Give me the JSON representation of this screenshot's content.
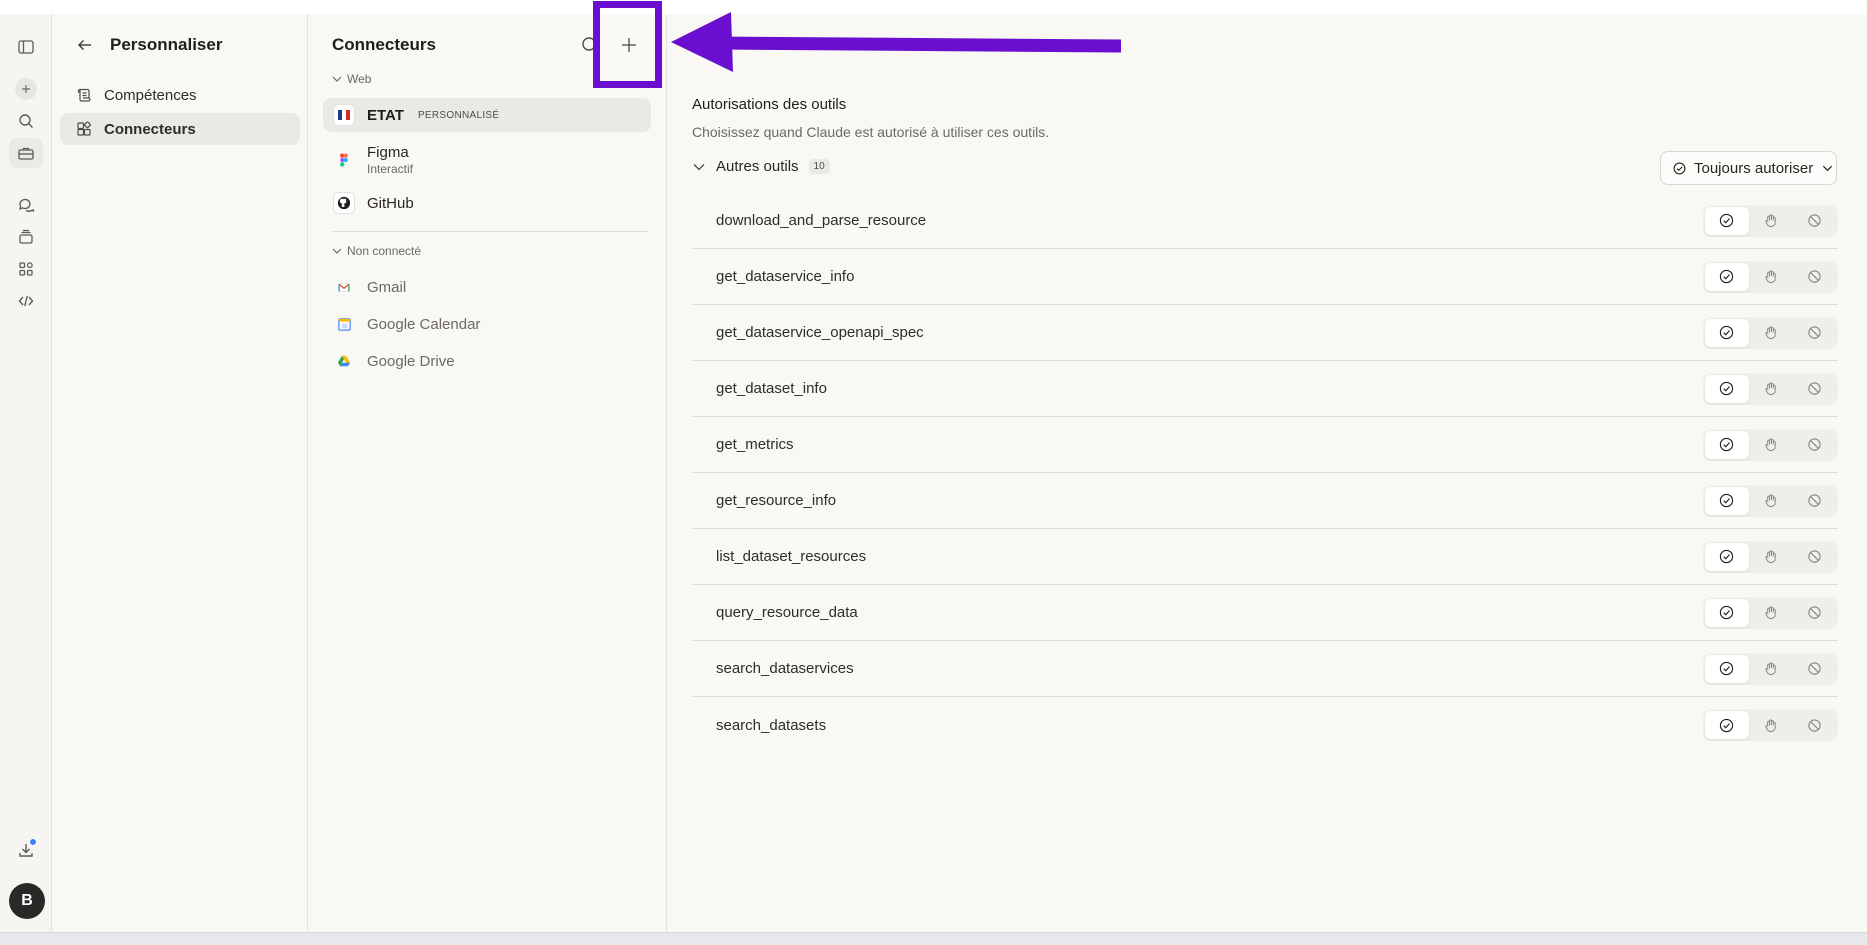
{
  "settings": {
    "back_label": "Personnaliser",
    "nav": [
      {
        "label": "Compétences",
        "active": false
      },
      {
        "label": "Connecteurs",
        "active": true
      }
    ]
  },
  "connectors": {
    "title": "Connecteurs",
    "sections": {
      "web": "Web",
      "not_connected": "Non connecté"
    },
    "connected": [
      {
        "name": "ETAT",
        "tag": "PERSONNALISÉ",
        "sub": ""
      },
      {
        "name": "Figma",
        "tag": "",
        "sub": "Interactif"
      },
      {
        "name": "GitHub",
        "tag": "",
        "sub": ""
      }
    ],
    "available": [
      {
        "name": "Gmail"
      },
      {
        "name": "Google Calendar"
      },
      {
        "name": "Google Drive"
      }
    ]
  },
  "permissions": {
    "title": "Autorisations des outils",
    "subtitle": "Choisissez quand Claude est autorisé à utiliser ces outils.",
    "group_label": "Autres outils",
    "group_count": "10",
    "bulk_label": "Toujours autoriser",
    "tools": [
      "download_and_parse_resource",
      "get_dataservice_info",
      "get_dataservice_openapi_spec",
      "get_dataset_info",
      "get_metrics",
      "get_resource_info",
      "list_dataset_resources",
      "query_resource_data",
      "search_dataservices",
      "search_datasets"
    ]
  },
  "user": {
    "initial": "B"
  },
  "colors": {
    "highlight": "#6a0fd0",
    "notification": "#3b82f6"
  },
  "icons": [
    "sidebar-toggle-icon",
    "plus-icon",
    "search-icon",
    "toolbox-icon",
    "chats-icon",
    "projects-icon",
    "artifacts-icon",
    "code-icon",
    "download-icon",
    "back-arrow-icon",
    "check-circle-icon",
    "hand-icon",
    "block-icon",
    "chevron-down-icon"
  ]
}
